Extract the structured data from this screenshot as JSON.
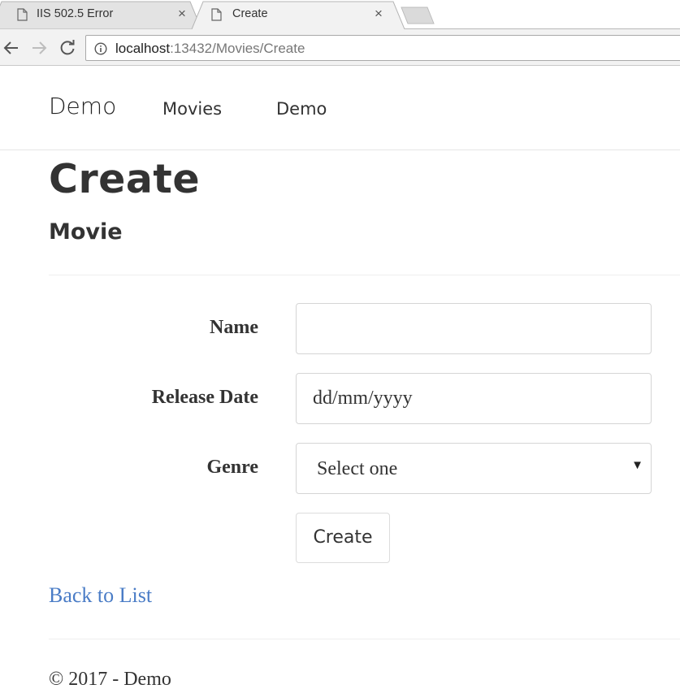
{
  "browser": {
    "tabs": [
      {
        "title": "IIS 502.5 Error",
        "active": false
      },
      {
        "title": "Create",
        "active": true
      }
    ],
    "close_glyph": "×",
    "address": {
      "host": "localhost",
      "path": ":13432/Movies/Create"
    },
    "icons": {
      "back": "arrow-left-icon",
      "forward": "arrow-right-icon",
      "reload": "reload-icon",
      "info": "info-icon",
      "tab": "document-icon"
    }
  },
  "navbar": {
    "brand": "Demo",
    "links": [
      "Movies",
      "Demo"
    ]
  },
  "page": {
    "title": "Create",
    "subtitle": "Movie"
  },
  "form": {
    "name_label": "Name",
    "name_value": "",
    "date_label": "Release Date",
    "date_placeholder": "dd/mm/yyyy",
    "genre_label": "Genre",
    "genre_selected": "Select one",
    "submit_label": "Create"
  },
  "back_link": "Back to List",
  "footer": "© 2017 - Demo",
  "colors": {
    "link": "#4a7cc6",
    "text": "#333333",
    "chrome": "#f2f2f2"
  }
}
